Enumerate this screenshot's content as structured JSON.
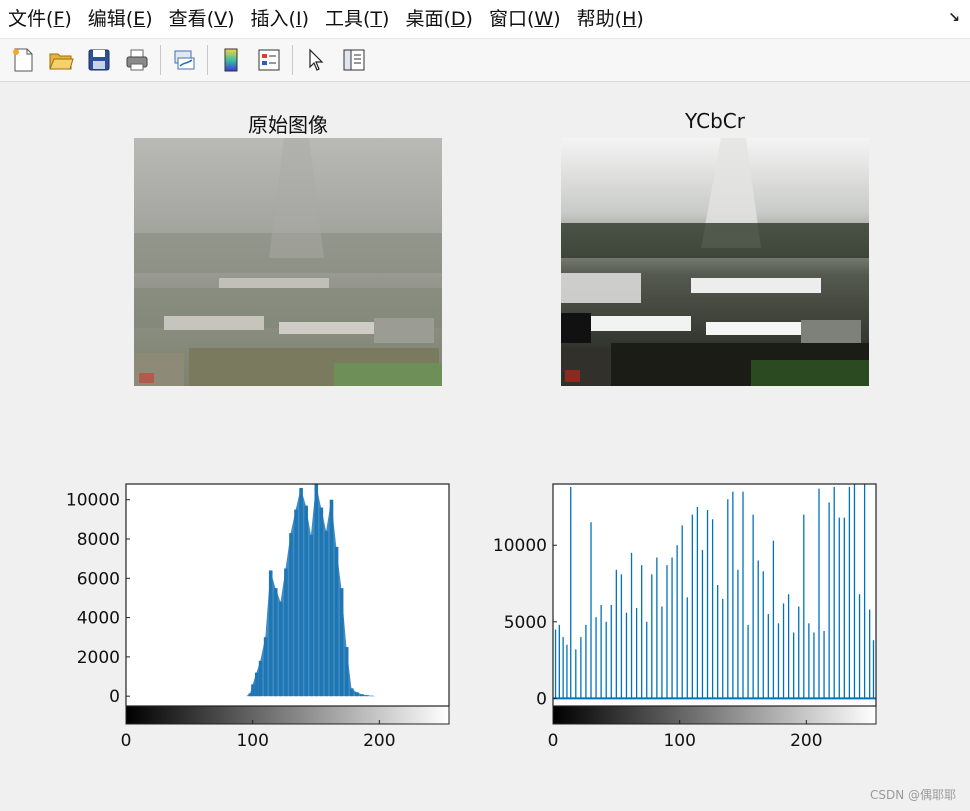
{
  "menu": [
    {
      "label": "文件",
      "key": "F"
    },
    {
      "label": "编辑",
      "key": "E"
    },
    {
      "label": "查看",
      "key": "V"
    },
    {
      "label": "插入",
      "key": "I"
    },
    {
      "label": "工具",
      "key": "T"
    },
    {
      "label": "桌面",
      "key": "D"
    },
    {
      "label": "窗口",
      "key": "W"
    },
    {
      "label": "帮助",
      "key": "H"
    }
  ],
  "toolbar_icons": [
    "new-figure-icon",
    "open-file-icon",
    "save-icon",
    "print-icon",
    "link-plot-icon",
    "colorbar-icon",
    "legend-icon",
    "edit-plot-cursor-icon",
    "property-inspector-icon"
  ],
  "titles": {
    "original": "原始图像",
    "ycbcr": "YCbCr"
  },
  "watermark": "CSDN @偶耶耶",
  "colors": {
    "bar": "#1f77b4",
    "line": "#0072bd",
    "plot_bg": "#ffffff",
    "figure_bg": "#f0f0f0"
  },
  "chart_data": [
    {
      "type": "bar",
      "xlim": [
        0,
        255
      ],
      "ylim": [
        -500,
        10800
      ],
      "xticks": [
        0,
        100,
        200
      ],
      "yticks": [
        0,
        2000,
        4000,
        6000,
        8000,
        10000
      ],
      "colorbar": "gray",
      "x": [
        95,
        98,
        100,
        103,
        106,
        110,
        114,
        118,
        122,
        126,
        130,
        134,
        138,
        142,
        146,
        150,
        154,
        158,
        162,
        166,
        170,
        174,
        178,
        182,
        186,
        190,
        194,
        198,
        202
      ],
      "y": [
        0,
        150,
        600,
        1200,
        1800,
        3000,
        6400,
        5500,
        4800,
        6500,
        8300,
        9500,
        10600,
        9700,
        8200,
        10800,
        9600,
        8400,
        10000,
        7600,
        5500,
        2500,
        400,
        200,
        100,
        50,
        20,
        0,
        0
      ]
    },
    {
      "type": "line",
      "xlim": [
        0,
        255
      ],
      "ylim": [
        -500,
        14000
      ],
      "xticks": [
        0,
        100,
        200
      ],
      "yticks": [
        0,
        5000,
        10000
      ],
      "colorbar": "gray",
      "x": [
        2,
        5,
        8,
        11,
        14,
        18,
        22,
        26,
        30,
        34,
        38,
        42,
        46,
        50,
        54,
        58,
        62,
        66,
        70,
        74,
        78,
        82,
        86,
        90,
        94,
        98,
        102,
        106,
        110,
        114,
        118,
        122,
        126,
        130,
        134,
        138,
        142,
        146,
        150,
        154,
        158,
        162,
        166,
        170,
        174,
        178,
        182,
        186,
        190,
        194,
        198,
        202,
        206,
        210,
        214,
        218,
        222,
        226,
        230,
        234,
        238,
        242,
        246,
        250,
        253
      ],
      "y": [
        4500,
        4800,
        4000,
        3500,
        13800,
        3200,
        4000,
        4800,
        11500,
        5300,
        6100,
        5000,
        6100,
        8400,
        8100,
        5600,
        9500,
        5900,
        8700,
        5000,
        8100,
        9200,
        6000,
        8700,
        9200,
        10000,
        11300,
        6600,
        12000,
        12500,
        9700,
        12300,
        11700,
        7400,
        6500,
        13000,
        13500,
        8400,
        13500,
        4800,
        12000,
        9000,
        8300,
        5500,
        10300,
        4900,
        6200,
        6800,
        4300,
        6000,
        12000,
        4900,
        4300,
        13700,
        4400,
        12800,
        13800,
        11800,
        11800,
        13800,
        14000,
        6800,
        14000,
        5800,
        3800
      ]
    }
  ]
}
